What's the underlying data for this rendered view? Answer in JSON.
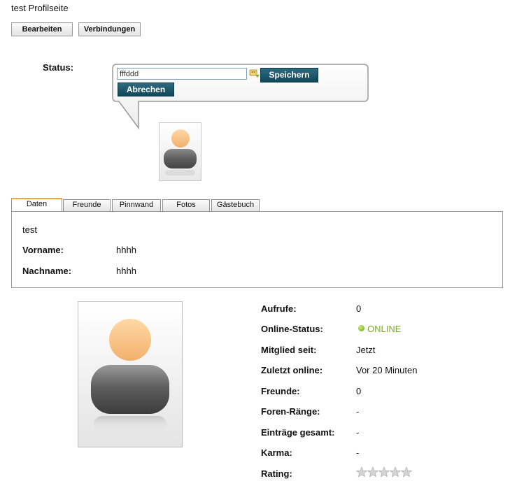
{
  "page": {
    "title": "test Profilseite"
  },
  "toolbar": {
    "edit_label": "Bearbeiten",
    "connections_label": "Verbindungen"
  },
  "status": {
    "label": "Status:",
    "input_value": "fffddd",
    "save_label": "Speichern",
    "cancel_label": "Abrechen",
    "emoji_icon": "emoticon-icon"
  },
  "tabs": [
    {
      "label": "Daten",
      "active": true
    },
    {
      "label": "Freunde",
      "active": false
    },
    {
      "label": "Pinnwand",
      "active": false
    },
    {
      "label": "Fotos",
      "active": false
    },
    {
      "label": "Gästebuch",
      "active": false
    }
  ],
  "panel": {
    "name": "test",
    "fields": [
      {
        "label": "Vorname:",
        "value": "hhhh"
      },
      {
        "label": "Nachname:",
        "value": "hhhh"
      }
    ]
  },
  "info": {
    "rows": [
      {
        "label": "Aufrufe:",
        "value": "0"
      },
      {
        "label": "Online-Status:",
        "value": "ONLINE"
      },
      {
        "label": "Mitglied seit:",
        "value": "Jetzt"
      },
      {
        "label": "Zuletzt online:",
        "value": "Vor 20 Minuten"
      },
      {
        "label": "Freunde:",
        "value": "0"
      },
      {
        "label": "Foren-Ränge:",
        "value": "-"
      },
      {
        "label": "Einträge gesamt:",
        "value": "-"
      },
      {
        "label": "Karma:",
        "value": "-"
      },
      {
        "label": "Rating:",
        "value": ""
      }
    ],
    "rating": {
      "stars": 0,
      "max": 5
    }
  },
  "colors": {
    "accent_dark": "#11475a",
    "tab_highlight": "#f2a531",
    "online_green": "#7cab2a"
  }
}
